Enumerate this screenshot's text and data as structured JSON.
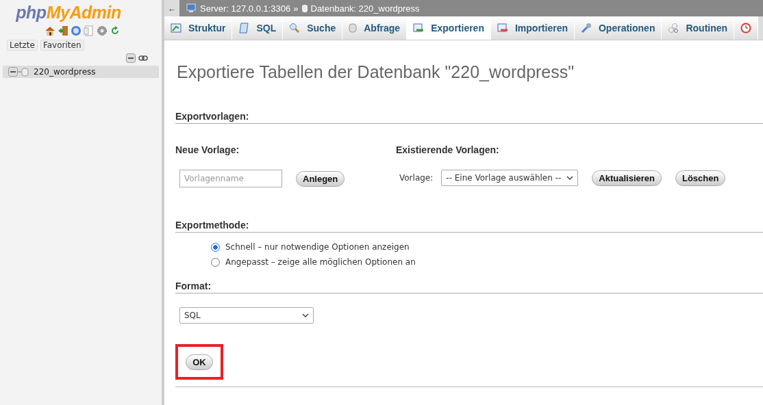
{
  "sidebar": {
    "logo": [
      "php",
      "MyAdmin"
    ],
    "buttons": [
      "Letzte",
      "Favoriten"
    ],
    "tree": [
      {
        "label": "220_wordpress",
        "expanded": true,
        "selected": true
      }
    ]
  },
  "breadcrumb": {
    "back": "←",
    "server": "Server: 127.0.0.1:3306",
    "separator": "»",
    "database": "Datenbank: 220_wordpress"
  },
  "tabs": [
    {
      "label": "Struktur",
      "selected": false
    },
    {
      "label": "SQL",
      "selected": false
    },
    {
      "label": "Suche",
      "selected": false
    },
    {
      "label": "Abfrage",
      "selected": false
    },
    {
      "label": "Exportieren",
      "selected": true
    },
    {
      "label": "Importieren",
      "selected": false
    },
    {
      "label": "Operationen",
      "selected": false
    },
    {
      "label": "Routinen",
      "selected": false
    },
    {
      "selected": false
    }
  ],
  "page_title": "Exportiere Tabellen der Datenbank \"220_wordpress\"",
  "templates": {
    "heading": "Exportvorlagen:",
    "new_heading": "Neue Vorlage:",
    "existing_heading": "Existierende Vorlagen:",
    "name_placeholder": "Vorlagenname",
    "create_button": "Anlegen",
    "select_label": "Vorlage:",
    "select_value": "-- Eine Vorlage auswählen --",
    "update_button": "Aktualisieren",
    "delete_button": "Löschen"
  },
  "method": {
    "heading": "Exportmethode:",
    "options": [
      {
        "label": "Schnell – nur notwendige Optionen anzeigen",
        "selected": true
      },
      {
        "label": "Angepasst – zeige alle möglichen Optionen an",
        "selected": false
      }
    ]
  },
  "format": {
    "heading": "Format:",
    "value": "SQL"
  },
  "ok_button": {
    "label": "OK",
    "highlighted": true
  }
}
